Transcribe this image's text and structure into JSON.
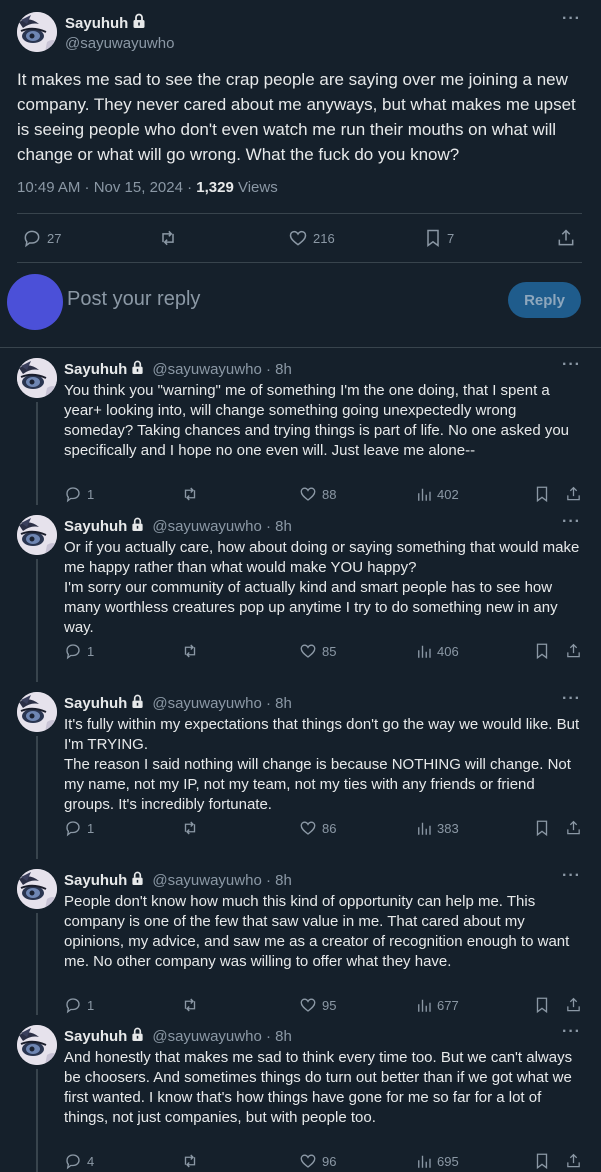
{
  "main": {
    "name": "Sayuhuh",
    "handle": "@sayuwayuwho",
    "text": "It makes me sad to see the crap people are saying over me joining a new company. They never cared about me anyways, but what makes me upset is seeing people who don't even watch me run their mouths on what will change or what will go wrong. What the fuck do you know?",
    "time": "10:49 AM · Nov 15, 2024 · ",
    "views_count": "1,329",
    "views_label": " Views",
    "replies": "27",
    "likes": "216",
    "bookmarks": "7"
  },
  "composer": {
    "placeholder": "Post your reply",
    "button": "Reply"
  },
  "replies": [
    {
      "name": "Sayuhuh",
      "handle": "@sayuwayuwho · 8h",
      "text": "You think you \"warning\" me of something I'm the one doing, that I spent a year+ looking into, will change something going unexpectedly wrong someday? Taking chances and trying things is part of life. No one asked you specifically and I hope no one even will. Just leave me alone--",
      "replies": "1",
      "likes": "88",
      "views": "402"
    },
    {
      "name": "Sayuhuh",
      "handle": "@sayuwayuwho · 8h",
      "text": "Or if you actually care, how about doing or saying something that would make me happy rather than what would make YOU happy?\nI'm sorry our community of actually kind and smart people has to see how many worthless creatures pop up anytime I try to do something new in any way.",
      "replies": "1",
      "likes": "85",
      "views": "406"
    },
    {
      "name": "Sayuhuh",
      "handle": "@sayuwayuwho · 8h",
      "text": "It's fully within my expectations that things don't go the way we would like. But I'm TRYING.\nThe reason I said nothing will change is because NOTHING will change. Not my name, not my IP, not my team, not my ties with any friends or friend groups. It's incredibly fortunate.",
      "replies": "1",
      "likes": "86",
      "views": "383"
    },
    {
      "name": "Sayuhuh",
      "handle": "@sayuwayuwho · 8h",
      "text": "People don't know how much this kind of opportunity can help me. This company is one of the few that saw value in me. That cared about my opinions, my advice, and saw me as a creator of recognition enough to want me. No other company was willing to offer what they have.",
      "replies": "1",
      "likes": "95",
      "views": "677"
    },
    {
      "name": "Sayuhuh",
      "handle": "@sayuwayuwho · 8h",
      "text": "And honestly that makes me sad to think every time too. But we can't always be choosers. And sometimes things do turn out better than if we got what we first wanted. I know that's how things have gone for me so far for a lot of things, not just companies, but with people too.",
      "replies": "4",
      "likes": "96",
      "views": "695"
    }
  ],
  "colors": {
    "background": "#15202b",
    "text": "#e7e9ea",
    "muted": "#8b98a5",
    "divider": "#38444d",
    "reply_button": "#1f5c8c",
    "composer_avatar": "#4b50d8"
  },
  "icons": [
    "lock-icon",
    "more-icon",
    "reply-icon",
    "retweet-icon",
    "like-icon",
    "views-icon",
    "bookmark-icon",
    "share-icon"
  ]
}
